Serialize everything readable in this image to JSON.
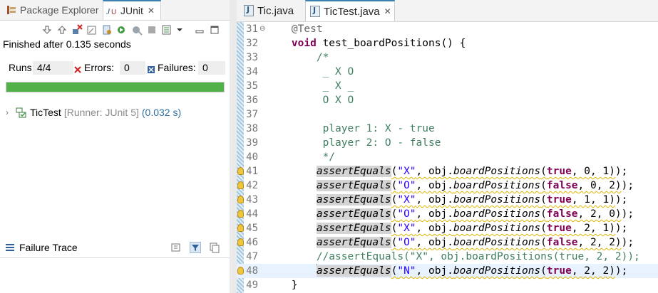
{
  "left_panel": {
    "tabs": [
      {
        "label": "Package Explorer",
        "icon": "package-explorer-icon"
      },
      {
        "label": "JUnit",
        "icon": "junit-icon"
      }
    ],
    "close_glyph": "✕",
    "status_text": "Finished after 0.135 seconds",
    "runs_label": "Runs:",
    "runs_value": "4/4",
    "errors_label": "Errors:",
    "errors_value": "0",
    "failures_label": "Failures:",
    "failures_value": "0",
    "progress_fraction": 1.0,
    "progress_color": "#52b049",
    "test_tree": {
      "name": "TicTest",
      "runner": "[Runner: JUnit 5]",
      "time": "(0.032 s)"
    },
    "failure_trace_title": "Failure Trace"
  },
  "editor": {
    "tabs": [
      {
        "label": "Tic.java",
        "active": false
      },
      {
        "label": "TicTest.java",
        "active": true
      }
    ],
    "close_glyph": "✕",
    "current_line": 48,
    "lines": [
      {
        "n": "31",
        "text": "    @Test"
      },
      {
        "n": "32",
        "text": "    void test_boardPositions() {"
      },
      {
        "n": "33",
        "text": "        /*"
      },
      {
        "n": "34",
        "text": "         _ X O"
      },
      {
        "n": "35",
        "text": "         _ X _"
      },
      {
        "n": "36",
        "text": "         O X O"
      },
      {
        "n": "37",
        "text": ""
      },
      {
        "n": "38",
        "text": "         player 1: X - true"
      },
      {
        "n": "39",
        "text": "         player 2: O - false"
      },
      {
        "n": "40",
        "text": "         */"
      },
      {
        "n": "41",
        "text": "        assertEquals(\"X\", obj.boardPositions(true, 0, 1));"
      },
      {
        "n": "42",
        "text": "        assertEquals(\"O\", obj.boardPositions(false, 0, 2));"
      },
      {
        "n": "43",
        "text": "        assertEquals(\"X\", obj.boardPositions(true, 1, 1));"
      },
      {
        "n": "44",
        "text": "        assertEquals(\"O\", obj.boardPositions(false, 2, 0));"
      },
      {
        "n": "45",
        "text": "        assertEquals(\"X\", obj.boardPositions(true, 2, 1));"
      },
      {
        "n": "46",
        "text": "        assertEquals(\"O\", obj.boardPositions(false, 2, 2));"
      },
      {
        "n": "47",
        "text": "        //assertEquals(\"X\", obj.boardPositions(true, 2, 2));"
      },
      {
        "n": "48",
        "text": "        assertEquals(\"N\", obj.boardPositions(true, 2, 2));"
      },
      {
        "n": "49",
        "text": "    }"
      }
    ]
  }
}
